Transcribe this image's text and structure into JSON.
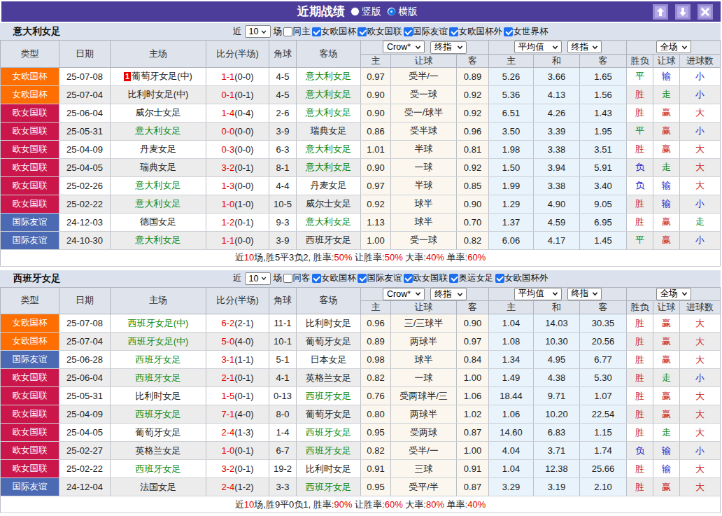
{
  "titlebar": {
    "title": "近期战绩",
    "radio_vertical_label": "竖版",
    "radio_horizontal_label": "横版"
  },
  "colors": {
    "titlebar_bg": "#4b3d99",
    "result_red": "#cb1e1e",
    "result_blue": "#2323cc",
    "result_green": "#0b890b",
    "score_red": "#e60000",
    "team_green": "#0b890b",
    "checkbox_blue": "#1b6ff0",
    "league_colors": {
      "女欧国杯": "#ff6e00",
      "欧女国联": "#cb164c",
      "国际友谊": "#4c6ab4"
    }
  },
  "header": {
    "left_cols": [
      "类型",
      "日期",
      "主场",
      "比分(半场)",
      "角球",
      "客场"
    ],
    "group1_selects": [
      "Crow*",
      "终指"
    ],
    "group2_selects": [
      "平均值",
      "终指"
    ],
    "group3_selects": [
      "全场"
    ],
    "sub_cols": [
      "主",
      "让球",
      "客",
      "主",
      "和",
      "客",
      "胜负",
      "让球",
      "进球数"
    ]
  },
  "filter_text": {
    "prefix": "近",
    "count": "10",
    "suffix": "场"
  },
  "tables": [
    {
      "team": "意大利女足",
      "same_filter": "同主",
      "leagues": [
        "女欧国杯",
        "欧女国联",
        "国际友谊",
        "女欧国杯外",
        "女世界杯"
      ],
      "rows": [
        {
          "type": "女欧国杯",
          "date": "25-07-08",
          "home": "葡萄牙女足(中)",
          "home_green": false,
          "home_badge": "1",
          "score": "1-1",
          "half": "(0-0)",
          "corner": "4-5",
          "away": "意大利女足",
          "away_green": true,
          "crow": [
            "0.97",
            "受半/一",
            "0.89"
          ],
          "avg": [
            "5.26",
            "3.66",
            "1.65"
          ],
          "results": [
            [
              "平",
              "g"
            ],
            [
              "输",
              "b"
            ],
            [
              "小",
              "b"
            ]
          ]
        },
        {
          "type": "女欧国杯",
          "date": "25-07-04",
          "home": "比利时女足(中)",
          "home_green": false,
          "score": "0-1",
          "half": "(0-1)",
          "corner": "4-5",
          "away": "意大利女足",
          "away_green": true,
          "crow": [
            "0.90",
            "受一球",
            "0.92"
          ],
          "avg": [
            "5.36",
            "4.13",
            "1.56"
          ],
          "results": [
            [
              "胜",
              "r"
            ],
            [
              "走",
              "g"
            ],
            [
              "小",
              "b"
            ]
          ]
        },
        {
          "type": "欧女国联",
          "date": "25-06-04",
          "home": "威尔士女足",
          "home_green": false,
          "score": "1-4",
          "half": "(0-4)",
          "corner": "2-6",
          "away": "意大利女足",
          "away_green": true,
          "crow": [
            "0.90",
            "受一/球半",
            "0.92"
          ],
          "avg": [
            "6.51",
            "4.26",
            "1.43"
          ],
          "results": [
            [
              "胜",
              "r"
            ],
            [
              "赢",
              "r"
            ],
            [
              "大",
              "r"
            ]
          ]
        },
        {
          "type": "欧女国联",
          "date": "25-05-31",
          "home": "意大利女足",
          "home_green": true,
          "score": "0-0",
          "half": "(0-0)",
          "corner": "3-9",
          "away": "瑞典女足",
          "away_green": false,
          "crow": [
            "0.86",
            "受半球",
            "0.96"
          ],
          "avg": [
            "3.50",
            "3.39",
            "1.95"
          ],
          "results": [
            [
              "平",
              "g"
            ],
            [
              "赢",
              "r"
            ],
            [
              "小",
              "b"
            ]
          ]
        },
        {
          "type": "欧女国联",
          "date": "25-04-09",
          "home": "丹麦女足",
          "home_green": false,
          "score": "0-3",
          "half": "(0-0)",
          "corner": "6-3",
          "away": "意大利女足",
          "away_green": true,
          "crow": [
            "1.01",
            "半球",
            "0.81"
          ],
          "avg": [
            "1.98",
            "3.38",
            "3.51"
          ],
          "results": [
            [
              "胜",
              "r"
            ],
            [
              "赢",
              "r"
            ],
            [
              "大",
              "r"
            ]
          ]
        },
        {
          "type": "欧女国联",
          "date": "25-04-05",
          "home": "瑞典女足",
          "home_green": false,
          "score": "3-2",
          "half": "(0-1)",
          "corner": "8-1",
          "away": "意大利女足",
          "away_green": true,
          "crow": [
            "0.90",
            "一球",
            "0.92"
          ],
          "avg": [
            "1.50",
            "3.94",
            "5.91"
          ],
          "results": [
            [
              "负",
              "b"
            ],
            [
              "走",
              "g"
            ],
            [
              "大",
              "r"
            ]
          ]
        },
        {
          "type": "欧女国联",
          "date": "25-02-26",
          "home": "意大利女足",
          "home_green": true,
          "score": "1-3",
          "half": "(0-0)",
          "corner": "4-4",
          "away": "丹麦女足",
          "away_green": false,
          "crow": [
            "0.97",
            "半球",
            "0.85"
          ],
          "avg": [
            "1.99",
            "3.38",
            "3.40"
          ],
          "results": [
            [
              "负",
              "b"
            ],
            [
              "输",
              "b"
            ],
            [
              "大",
              "r"
            ]
          ]
        },
        {
          "type": "欧女国联",
          "date": "25-02-22",
          "home": "意大利女足",
          "home_green": true,
          "score": "1-0",
          "half": "(1-0)",
          "corner": "10-5",
          "away": "威尔士女足",
          "away_green": false,
          "crow": [
            "0.92",
            "球半",
            "0.90"
          ],
          "avg": [
            "1.29",
            "4.90",
            "9.05"
          ],
          "results": [
            [
              "胜",
              "r"
            ],
            [
              "输",
              "b"
            ],
            [
              "小",
              "b"
            ]
          ]
        },
        {
          "type": "国际友谊",
          "date": "24-12-03",
          "home": "德国女足",
          "home_green": false,
          "score": "1-2",
          "half": "(0-1)",
          "corner": "9-3",
          "away": "意大利女足",
          "away_green": true,
          "crow": [
            "1.13",
            "球半",
            "0.70"
          ],
          "avg": [
            "1.37",
            "4.59",
            "6.95"
          ],
          "results": [
            [
              "胜",
              "r"
            ],
            [
              "赢",
              "r"
            ],
            [
              "走",
              "g"
            ]
          ]
        },
        {
          "type": "国际友谊",
          "date": "24-10-30",
          "home": "意大利女足",
          "home_green": true,
          "score": "1-1",
          "half": "(0-0)",
          "corner": "3-9",
          "away": "西班牙女足",
          "away_green": false,
          "crow": [
            "1.00",
            "受一球",
            "0.82"
          ],
          "avg": [
            "6.06",
            "4.17",
            "1.45"
          ],
          "results": [
            [
              "平",
              "g"
            ],
            [
              "赢",
              "r"
            ],
            [
              "小",
              "b"
            ]
          ]
        }
      ],
      "summary": [
        [
          "近",
          "k"
        ],
        [
          "10",
          "r"
        ],
        [
          "场,胜5平3负2, 胜率:",
          "k"
        ],
        [
          "50%",
          "r"
        ],
        [
          " 让胜率:",
          "k"
        ],
        [
          "50%",
          "r"
        ],
        [
          " 大率:",
          "k"
        ],
        [
          "40%",
          "r"
        ],
        [
          " 单率:",
          "k"
        ],
        [
          "60%",
          "r"
        ]
      ]
    },
    {
      "team": "西班牙女足",
      "same_filter": "同客",
      "leagues": [
        "女欧国杯",
        "国际友谊",
        "欧女国联",
        "奥运女足",
        "女欧国杯外"
      ],
      "rows": [
        {
          "type": "女欧国杯",
          "date": "25-07-08",
          "home": "西班牙女足(中)",
          "home_green": true,
          "score": "6-2",
          "half": "(2-1)",
          "corner": "11-1",
          "away": "比利时女足",
          "away_green": false,
          "crow": [
            "0.96",
            "三/三球半",
            "0.90"
          ],
          "avg": [
            "1.04",
            "14.03",
            "30.35"
          ],
          "results": [
            [
              "胜",
              "r"
            ],
            [
              "赢",
              "r"
            ],
            [
              "大",
              "r"
            ]
          ]
        },
        {
          "type": "女欧国杯",
          "date": "25-07-04",
          "home": "西班牙女足(中)",
          "home_green": true,
          "score": "5-0",
          "half": "(4-0)",
          "corner": "10-1",
          "away": "葡萄牙女足",
          "away_green": false,
          "crow": [
            "0.89",
            "两球半",
            "0.97"
          ],
          "avg": [
            "1.08",
            "10.30",
            "20.56"
          ],
          "results": [
            [
              "胜",
              "r"
            ],
            [
              "赢",
              "r"
            ],
            [
              "大",
              "r"
            ]
          ]
        },
        {
          "type": "国际友谊",
          "date": "25-06-28",
          "home": "西班牙女足",
          "home_green": true,
          "score": "3-1",
          "half": "(1-1)",
          "corner": "5-1",
          "away": "日本女足",
          "away_green": false,
          "crow": [
            "0.98",
            "球半",
            "0.84"
          ],
          "avg": [
            "1.34",
            "4.95",
            "6.77"
          ],
          "results": [
            [
              "胜",
              "r"
            ],
            [
              "赢",
              "r"
            ],
            [
              "大",
              "r"
            ]
          ]
        },
        {
          "type": "欧女国联",
          "date": "25-06-04",
          "home": "西班牙女足",
          "home_green": true,
          "score": "2-1",
          "half": "(0-1)",
          "corner": "4-1",
          "away": "英格兰女足",
          "away_green": false,
          "crow": [
            "0.82",
            "一球",
            "1.00"
          ],
          "avg": [
            "1.49",
            "4.38",
            "5.30"
          ],
          "results": [
            [
              "胜",
              "r"
            ],
            [
              "走",
              "g"
            ],
            [
              "小",
              "b"
            ]
          ]
        },
        {
          "type": "欧女国联",
          "date": "25-05-31",
          "home": "比利时女足",
          "home_green": false,
          "score": "1-5",
          "half": "(0-1)",
          "corner": "0-13",
          "away": "西班牙女足",
          "away_green": true,
          "crow": [
            "0.76",
            "受两球半/三",
            "1.06"
          ],
          "avg": [
            "18.44",
            "9.71",
            "1.07"
          ],
          "results": [
            [
              "胜",
              "r"
            ],
            [
              "赢",
              "r"
            ],
            [
              "大",
              "r"
            ]
          ]
        },
        {
          "type": "欧女国联",
          "date": "25-04-09",
          "home": "西班牙女足",
          "home_green": true,
          "score": "7-1",
          "half": "(4-0)",
          "corner": "8-0",
          "away": "葡萄牙女足",
          "away_green": false,
          "crow": [
            "0.80",
            "两球半",
            "1.02"
          ],
          "avg": [
            "1.06",
            "10.20",
            "22.54"
          ],
          "results": [
            [
              "胜",
              "r"
            ],
            [
              "赢",
              "r"
            ],
            [
              "大",
              "r"
            ]
          ]
        },
        {
          "type": "欧女国联",
          "date": "25-04-05",
          "home": "葡萄牙女足",
          "home_green": false,
          "score": "2-4",
          "half": "(1-3)",
          "corner": "1-4",
          "away": "西班牙女足",
          "away_green": true,
          "crow": [
            "0.95",
            "受两球",
            "0.87"
          ],
          "avg": [
            "14.60",
            "6.83",
            "1.15"
          ],
          "results": [
            [
              "胜",
              "r"
            ],
            [
              "走",
              "g"
            ],
            [
              "大",
              "r"
            ]
          ]
        },
        {
          "type": "欧女国联",
          "date": "25-02-27",
          "home": "英格兰女足",
          "home_green": false,
          "score": "1-0",
          "half": "(0-1)",
          "corner": "6-7",
          "away": "西班牙女足",
          "away_green": true,
          "crow": [
            "0.82",
            "受半/一",
            "1.00"
          ],
          "avg": [
            "4.04",
            "3.71",
            "1.74"
          ],
          "results": [
            [
              "负",
              "b"
            ],
            [
              "输",
              "b"
            ],
            [
              "小",
              "b"
            ]
          ]
        },
        {
          "type": "欧女国联",
          "date": "25-02-22",
          "home": "西班牙女足",
          "home_green": true,
          "score": "3-2",
          "half": "(0-1)",
          "corner": "19-2",
          "away": "比利时女足",
          "away_green": false,
          "crow": [
            "0.91",
            "三球",
            "0.91"
          ],
          "avg": [
            "1.04",
            "12.38",
            "25.66"
          ],
          "results": [
            [
              "胜",
              "r"
            ],
            [
              "输",
              "b"
            ],
            [
              "大",
              "r"
            ]
          ]
        },
        {
          "type": "国际友谊",
          "date": "24-12-04",
          "home": "法国女足",
          "home_green": false,
          "score": "2-4",
          "half": "(1-2)",
          "corner": "3-3",
          "away": "西班牙女足",
          "away_green": true,
          "crow": [
            "0.95",
            "受平/半",
            "0.87"
          ],
          "avg": [
            "3.29",
            "3.19",
            "2.10"
          ],
          "results": [
            [
              "胜",
              "r"
            ],
            [
              "赢",
              "r"
            ],
            [
              "大",
              "r"
            ]
          ]
        }
      ],
      "summary": [
        [
          "近",
          "k"
        ],
        [
          "10",
          "r"
        ],
        [
          "场,胜9平0负1, 胜率:",
          "k"
        ],
        [
          "90%",
          "r"
        ],
        [
          " 让胜率:",
          "k"
        ],
        [
          "60%",
          "r"
        ],
        [
          " 大率:",
          "k"
        ],
        [
          "80%",
          "r"
        ],
        [
          " 单率:",
          "k"
        ],
        [
          "40%",
          "r"
        ]
      ]
    }
  ]
}
